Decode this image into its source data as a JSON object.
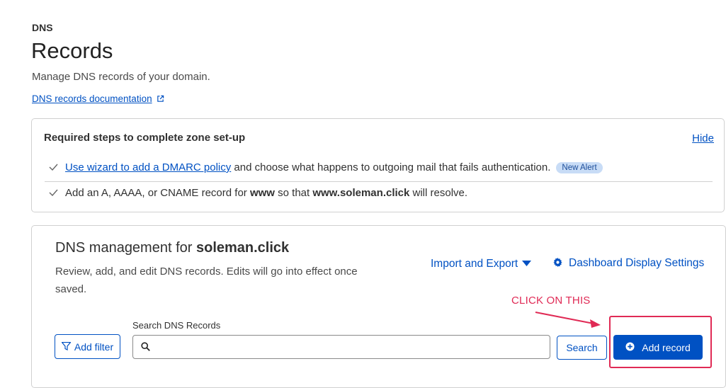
{
  "header": {
    "eyebrow": "DNS",
    "title": "Records",
    "subtitle": "Manage DNS records of your domain.",
    "doc_link": "DNS records documentation"
  },
  "setup_card": {
    "title": "Required steps to complete zone set-up",
    "hide_label": "Hide",
    "step1": {
      "link": "Use wizard to add a DMARC policy",
      "text": " and choose what happens to outgoing mail that fails authentication.",
      "badge": "New Alert"
    },
    "step2": {
      "pre": "Add an A, AAAA, or CNAME record for ",
      "bold1": "www",
      "mid": " so that ",
      "bold2": "www.soleman.click",
      "post": " will resolve."
    }
  },
  "dns_card": {
    "title_prefix": "DNS management for ",
    "domain": "soleman.click",
    "description": "Review, add, and edit DNS records. Edits will go into effect once saved.",
    "import_export_label": "Import and Export",
    "display_settings_label": "Dashboard Display Settings",
    "add_filter_label": "Add filter",
    "search_label": "Search DNS Records",
    "search_value": "",
    "search_placeholder": "",
    "search_button_label": "Search",
    "add_record_label": "Add record"
  },
  "annotation": {
    "text": "CLICK ON THIS",
    "color": "#e02a55"
  },
  "colors": {
    "accent": "#0051c3",
    "badge_bg": "#c8dcf6"
  },
  "icons": [
    "external-link-icon",
    "check-icon",
    "chevron-down-icon",
    "gear-icon",
    "filter-icon",
    "search-icon",
    "plus-circle-icon"
  ]
}
